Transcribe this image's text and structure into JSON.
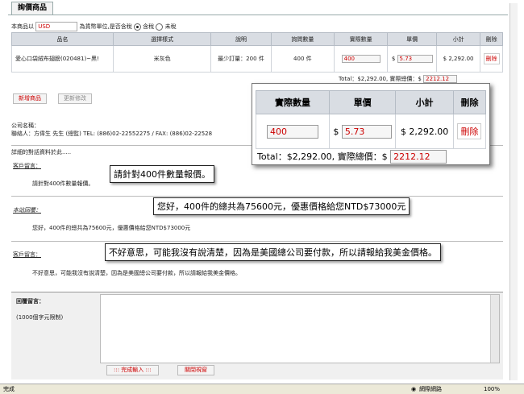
{
  "tab": "詢價商品",
  "currency_row": {
    "prefix": "本商品以",
    "currency": "USD",
    "suffix": "為貨幣單位,是否含稅",
    "tax_inc": "含稅",
    "tax_exc": "未稅"
  },
  "table": {
    "headers": [
      "品名",
      "選擇樣式",
      "說明",
      "詢問數量",
      "實際數量",
      "單價",
      "小計",
      "刪除"
    ],
    "row": {
      "name": "愛心口袋絨布翅膀(020481)~黑!",
      "style": "米灰色",
      "desc": "最少訂量：200 件",
      "ask_qty": "400 件",
      "qty": "400",
      "currency_sign": "$",
      "price": "5.73",
      "subtotal": "$ 2,292.00",
      "delete": "刪除"
    }
  },
  "total_line": {
    "text": "Total：$2,292.00, 實際總價：$",
    "value": "2212.12"
  },
  "buttons": {
    "add": "新增商品",
    "update": "更新修改"
  },
  "company": {
    "name_label": "公司名稱：",
    "contact": "聯絡人：方偉生 先生 (總監) TEL: (886)02-22552275 / FAX: (886)02-22528"
  },
  "details_label": "詳細的對話資料於此.....",
  "messages": [
    {
      "label": "客戶留言：",
      "body": "請針對400件數量報價。"
    },
    {
      "label": "本站回覆：",
      "body": "您好，400件的總共為75600元，優惠價格給您NTD$73000元"
    },
    {
      "label": "客戶留言：",
      "body": "不好意思，可能我沒有說清楚，因為是美國總公司要付款，所以請報給我美金價格。"
    }
  ],
  "reply": {
    "label": "回覆留言：",
    "limit": "(1000個字元限制)",
    "submit": "::: 完成輸入 :::",
    "close": "關閉視窗"
  },
  "status": {
    "left": "完成",
    "zone": "網際網路",
    "zoom": "100%"
  },
  "callouts": {
    "c1": "請針對400件數量報價。",
    "c2": "您好，400件的總共為75600元，優惠價格給您NTD$73000元",
    "c3": "不好意思，可能我沒有說清楚，因為是美國總公司要付款，所以請報給我美金價格。"
  },
  "zoom": {
    "headers": [
      "實際數量",
      "單價",
      "小計",
      "刪除"
    ],
    "qty": "400",
    "currency_sign": "$",
    "price": "5.73",
    "subtotal": "$ 2,292.00",
    "delete": "刪除",
    "total_text": "Total：$2,292.00, 實際總價：$",
    "total_value": "2212.12"
  }
}
